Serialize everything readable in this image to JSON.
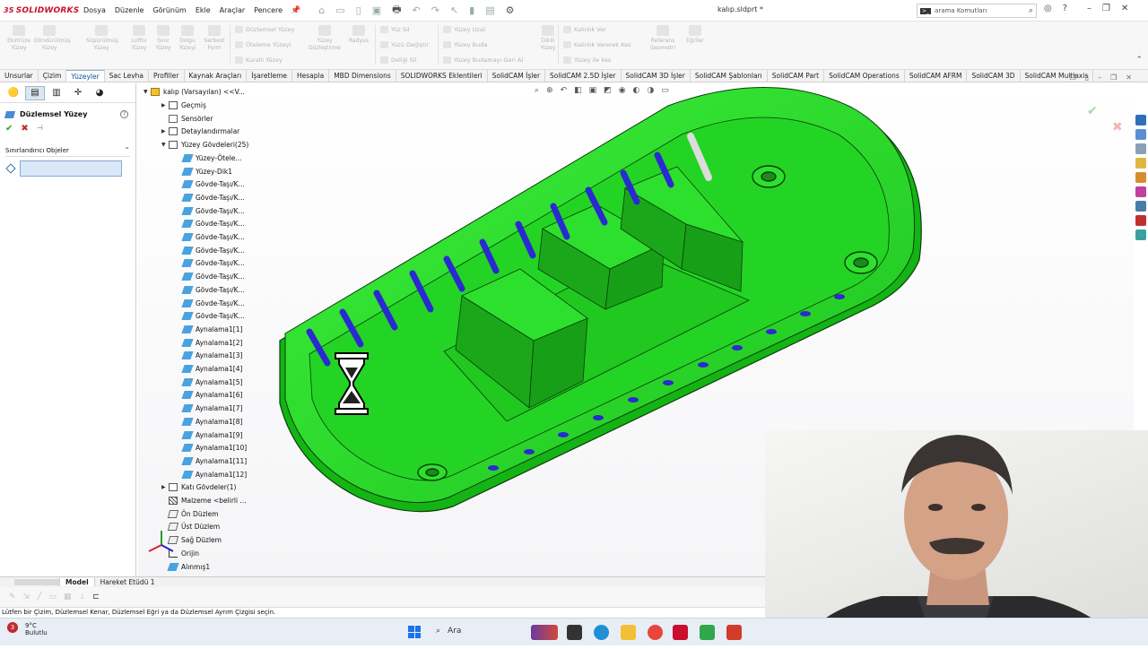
{
  "app": {
    "brand": "SOLIDWORKS",
    "brand_prefix": "3S",
    "document_title": "kalıp.sldprt *",
    "menu": [
      "Dosya",
      "Düzenle",
      "Görünüm",
      "Ekle",
      "Araçlar",
      "Pencere"
    ],
    "search_placeholder": "arama Komutları"
  },
  "ribbon": {
    "big_buttons": [
      "Ekstrüze Yüzey",
      "Döndürülmüş Yüzey",
      "Süpürülmüş Yüzey",
      "Loftlu Yüzey",
      "Sınır Yüzey",
      "Dolgu Yüzeyi",
      "Serbest Form"
    ],
    "group2": [
      "Düzlemsel Yüzey",
      "Öteleme Yüzeyi",
      "Kurallı Yüzey"
    ],
    "group2_big": [
      "Yüzey Düzleştirme",
      "Radyus"
    ],
    "group3": [
      "Yüz Sil",
      "Yüzü Değiştir",
      "Deliği Sil"
    ],
    "group4": [
      "Yüzey Uzat",
      "Yüzey Buda",
      "Yüzey Budamayı Geri Al"
    ],
    "group4_big": [
      "Dikili Yüzey"
    ],
    "group5": [
      "Kalınlık Ver",
      "Kalınlık Vererek Kes",
      "Yüzey ile kes"
    ],
    "group5_big": [
      "Referans Geometri",
      "Eğriler"
    ]
  },
  "tabs": [
    "Unsurlar",
    "Çizim",
    "Yüzeyler",
    "Sac Levha",
    "Profiller",
    "Kaynak Araçları",
    "İşaretleme",
    "Hesapla",
    "MBD Dimensions",
    "SOLIDWORKS Eklentileri",
    "SolidCAM İşler",
    "SolidCAM 2.5D İşler",
    "SolidCAM 3D İşler",
    "SolidCAM Şablonları",
    "SolidCAM Part",
    "SolidCAM Operations",
    "SolidCAM AFRM",
    "SolidCAM 3D",
    "SolidCAM Multiaxis"
  ],
  "active_tab": "Yüzeyler",
  "property_manager": {
    "title": "Düzlemsel Yüzey",
    "group": "Sınırlandırıcı Objeler"
  },
  "tree": {
    "root": "kalıp (Varsayılan) <<V...",
    "items": [
      {
        "label": "Geçmiş",
        "icon": "folder",
        "arrow": "▶",
        "indent": 1
      },
      {
        "label": "Sensörler",
        "icon": "sens",
        "arrow": "",
        "indent": 1
      },
      {
        "label": "Detaylandırmalar",
        "icon": "folder",
        "arrow": "▶",
        "indent": 1
      },
      {
        "label": "Yüzey Gövdeleri(25)",
        "icon": "folder",
        "arrow": "▼",
        "indent": 1
      },
      {
        "label": "Yüzey-Ötele...",
        "icon": "surf",
        "arrow": "",
        "indent": 2
      },
      {
        "label": "Yüzey-Dik1",
        "icon": "surf",
        "arrow": "",
        "indent": 2
      },
      {
        "label": "Gövde-Taşı/K...",
        "icon": "surf",
        "arrow": "",
        "indent": 2
      },
      {
        "label": "Gövde-Taşı/K...",
        "icon": "surf",
        "arrow": "",
        "indent": 2
      },
      {
        "label": "Gövde-Taşı/K...",
        "icon": "surf",
        "arrow": "",
        "indent": 2
      },
      {
        "label": "Gövde-Taşı/K...",
        "icon": "surf",
        "arrow": "",
        "indent": 2
      },
      {
        "label": "Gövde-Taşı/K...",
        "icon": "surf",
        "arrow": "",
        "indent": 2
      },
      {
        "label": "Gövde-Taşı/K...",
        "icon": "surf",
        "arrow": "",
        "indent": 2
      },
      {
        "label": "Gövde-Taşı/K...",
        "icon": "surf",
        "arrow": "",
        "indent": 2
      },
      {
        "label": "Gövde-Taşı/K...",
        "icon": "surf",
        "arrow": "",
        "indent": 2
      },
      {
        "label": "Gövde-Taşı/K...",
        "icon": "surf",
        "arrow": "",
        "indent": 2
      },
      {
        "label": "Gövde-Taşı/K...",
        "icon": "surf",
        "arrow": "",
        "indent": 2
      },
      {
        "label": "Gövde-Taşı/K...",
        "icon": "surf",
        "arrow": "",
        "indent": 2
      },
      {
        "label": "Aynalama1[1]",
        "icon": "surf",
        "arrow": "",
        "indent": 2
      },
      {
        "label": "Aynalama1[2]",
        "icon": "surf",
        "arrow": "",
        "indent": 2
      },
      {
        "label": "Aynalama1[3]",
        "icon": "surf",
        "arrow": "",
        "indent": 2
      },
      {
        "label": "Aynalama1[4]",
        "icon": "surf",
        "arrow": "",
        "indent": 2
      },
      {
        "label": "Aynalama1[5]",
        "icon": "surf",
        "arrow": "",
        "indent": 2
      },
      {
        "label": "Aynalama1[6]",
        "icon": "surf",
        "arrow": "",
        "indent": 2
      },
      {
        "label": "Aynalama1[7]",
        "icon": "surf",
        "arrow": "",
        "indent": 2
      },
      {
        "label": "Aynalama1[8]",
        "icon": "surf",
        "arrow": "",
        "indent": 2
      },
      {
        "label": "Aynalama1[9]",
        "icon": "surf",
        "arrow": "",
        "indent": 2
      },
      {
        "label": "Aynalama1[10]",
        "icon": "surf",
        "arrow": "",
        "indent": 2
      },
      {
        "label": "Aynalama1[11]",
        "icon": "surf",
        "arrow": "",
        "indent": 2
      },
      {
        "label": "Aynalama1[12]",
        "icon": "surf",
        "arrow": "",
        "indent": 2
      },
      {
        "label": "Katı Gövdeler(1)",
        "icon": "folder",
        "arrow": "▶",
        "indent": 1
      },
      {
        "label": "Malzeme <belirli ...",
        "icon": "mat",
        "arrow": "",
        "indent": 1
      },
      {
        "label": "Ön Düzlem",
        "icon": "plane",
        "arrow": "",
        "indent": 1
      },
      {
        "label": "Üst Düzlem",
        "icon": "plane",
        "arrow": "",
        "indent": 1
      },
      {
        "label": "Sağ Düzlem",
        "icon": "plane",
        "arrow": "",
        "indent": 1
      },
      {
        "label": "Orijin",
        "icon": "orig",
        "arrow": "",
        "indent": 1
      },
      {
        "label": "Alınmış1",
        "icon": "surf",
        "arrow": "",
        "indent": 1
      }
    ]
  },
  "bottom_tabs": [
    "Model",
    "Hareket Etüdü 1"
  ],
  "status_text": "Lütfen bir Çizim, Düzlemsel Kenar, Düzlemsel Eğri ya da Düzlemsel Ayrım Çizgisi seçin.",
  "taskbar": {
    "temperature": "9°C",
    "weather": "Bulutlu",
    "search": "Ara",
    "badge": "3"
  },
  "colors": {
    "model_green": "#22d622",
    "model_edge": "#0b3d0b",
    "slot_blue": "#2a2ad0",
    "active_tab": "#0a4f9e"
  }
}
